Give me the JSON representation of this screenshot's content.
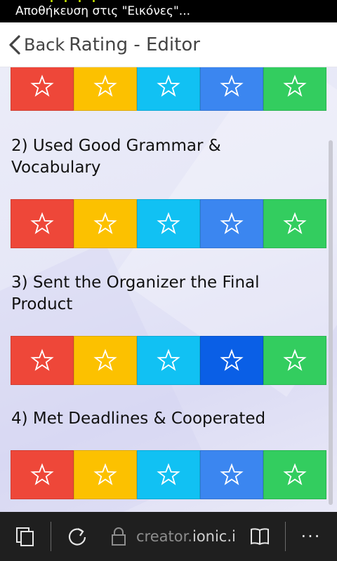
{
  "status_bar": {
    "text": "Αποθήκευση στις \"Εικόνες\"..."
  },
  "header": {
    "back_label": "Back",
    "title": "Rating - Editor"
  },
  "colors": {
    "star_red": "#ee4739",
    "star_yellow": "#fcc100",
    "star_cyan": "#11c1f3",
    "star_blue": "#3b86f0",
    "star_blue_active": "#0a5fe6",
    "star_green": "#33cd5f"
  },
  "questions": [
    {
      "label": "2) Used Good Grammar & Vocabulary"
    },
    {
      "label": "3) Sent the Organizer the Final Product"
    },
    {
      "label": "4) Met Deadlines & Cooperated"
    }
  ],
  "star_icon": "star-outline-icon",
  "browser_bar": {
    "url_domain_prefix": "creator.",
    "url_domain_main": "ionic.ic",
    "icons": [
      "tabs-icon",
      "refresh-icon",
      "lock-icon",
      "reading-view-icon",
      "more-icon"
    ]
  }
}
